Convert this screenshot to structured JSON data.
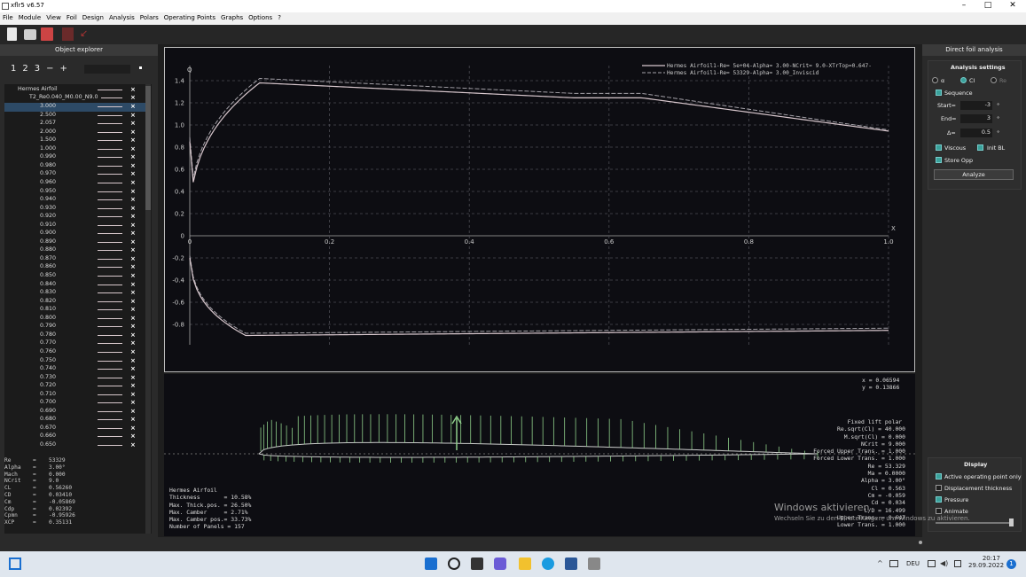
{
  "app": {
    "title": "xflr5 v6.57"
  },
  "window_controls": {
    "minimize": "–",
    "maximize": "□",
    "close": "✕"
  },
  "menu": [
    "File",
    "Module",
    "View",
    "Foil",
    "Design",
    "Analysis",
    "Polars",
    "Operating Points",
    "Graphs",
    "Options",
    "?"
  ],
  "explorer": {
    "header": "Object explorer",
    "tabs": [
      "1",
      "2",
      "3",
      "−",
      "+"
    ],
    "foil": "Hermes Airfoil",
    "polar": "T2_Re0.040_M0.00_N9.0",
    "opps": [
      "3.000",
      "2.500",
      "2.057",
      "2.000",
      "1.500",
      "1.000",
      "0.990",
      "0.980",
      "0.970",
      "0.960",
      "0.950",
      "0.940",
      "0.930",
      "0.920",
      "0.910",
      "0.900",
      "0.890",
      "0.880",
      "0.870",
      "0.860",
      "0.850",
      "0.840",
      "0.830",
      "0.820",
      "0.810",
      "0.800",
      "0.790",
      "0.780",
      "0.770",
      "0.760",
      "0.750",
      "0.740",
      "0.730",
      "0.720",
      "0.710",
      "0.700",
      "0.690",
      "0.680",
      "0.670",
      "0.660",
      "0.650"
    ]
  },
  "opp_info": [
    {
      "k": "Re",
      "v": "53329"
    },
    {
      "k": "Alpha",
      "v": "3.00°"
    },
    {
      "k": "Mach",
      "v": "0.000"
    },
    {
      "k": "NCrit",
      "v": "9.0"
    },
    {
      "k": "CL",
      "v": "0.56260"
    },
    {
      "k": "CD",
      "v": "0.03410"
    },
    {
      "k": "Cm",
      "v": "-0.05869"
    },
    {
      "k": "Cdp",
      "v": "0.02392"
    },
    {
      "k": "Cpmn",
      "v": "-0.95926"
    },
    {
      "k": "XCP",
      "v": "0.35131"
    }
  ],
  "graph": {
    "y_label": "Q",
    "x_label": "X",
    "y_ticks": [
      "1.4",
      "1.2",
      "1.0",
      "0.8",
      "0.6",
      "0.4",
      "0.2",
      "0",
      "-0.2",
      "-0.4",
      "-0.6",
      "-0.8"
    ],
    "x_ticks": [
      "0",
      "0.2",
      "0.4",
      "0.6",
      "0.8",
      "1.0"
    ],
    "legend": [
      "Hermes Airfoil1-Re=   5e+04-Alpha= 3.00-NCrit=  9.0-XTrTop=0.647-",
      "Hermes Airfoil1-Re=   53329-Alpha= 3.00_Inviscid"
    ],
    "colors": {
      "viscous": "#d9c8ce",
      "inviscid": "#a5a2a9",
      "grid": "#4a4a52",
      "cp": "#8fcf8a"
    }
  },
  "cursor": {
    "x_label": "x =",
    "x_value": "0.06594",
    "y_label": "y =",
    "y_value": "0.13866"
  },
  "foil_props": [
    {
      "k": "Hermes Airfoil",
      "v": ""
    },
    {
      "k": "Thickness       =",
      "v": "10.58%"
    },
    {
      "k": "Max. Thick.pos. =",
      "v": "26.50%"
    },
    {
      "k": "Max. Camber     =",
      "v": "2.71%"
    },
    {
      "k": "Max. Camber pos.=",
      "v": "33.73%"
    },
    {
      "k": "Number of Panels =",
      "v": "157"
    }
  ],
  "polar_props": [
    {
      "k": "Fixed lift polar",
      "v": ""
    },
    {
      "k": "Re.sqrt(Cl) =",
      "v": "40.000"
    },
    {
      "k": "M.sqrt(Cl) =",
      "v": "0.000"
    },
    {
      "k": "NCrit =",
      "v": "9.000"
    },
    {
      "k": "Forced Upper Trans. =",
      "v": "1.000"
    },
    {
      "k": "Forced Lower Trans. =",
      "v": "1.000"
    },
    {
      "k": "Re =",
      "v": "53.329"
    },
    {
      "k": "Ma =",
      "v": "0.0000"
    },
    {
      "k": "Alpha =",
      "v": "3.00°"
    },
    {
      "k": "Cl =",
      "v": "0.563"
    },
    {
      "k": "Cm =",
      "v": "-0.059"
    },
    {
      "k": "Cd =",
      "v": "0.034"
    },
    {
      "k": "L/D =",
      "v": "16.499"
    },
    {
      "k": "Upper Trans. =",
      "v": "0.647"
    },
    {
      "k": "Lower Trans. =",
      "v": "1.000"
    }
  ],
  "right": {
    "header": "Direct foil analysis",
    "settings_title": "Analysis settings",
    "radio": [
      "α",
      "Cl",
      "Re"
    ],
    "sequence": "Sequence",
    "start_label": "Start=",
    "start": "-3",
    "end_label": "End=",
    "end": "3",
    "delta_label": "Δ=",
    "delta": "0.5",
    "unit": "°",
    "viscous": "Viscous",
    "initbl": "Init BL",
    "storeopp": "Store Opp",
    "analyze": "Analyze",
    "display_title": "Display",
    "display_opts": [
      "Active operating point only",
      "Displacement thickness",
      "Pressure",
      "Animate"
    ]
  },
  "watermark": {
    "line1": "Windows aktivieren",
    "line2": "Wechseln Sie zu den Einstellungen, um Windows zu aktivieren."
  },
  "taskbar": {
    "time": "20:17",
    "date": "29.09.2022",
    "lang": "DEU",
    "notif": "1"
  }
}
